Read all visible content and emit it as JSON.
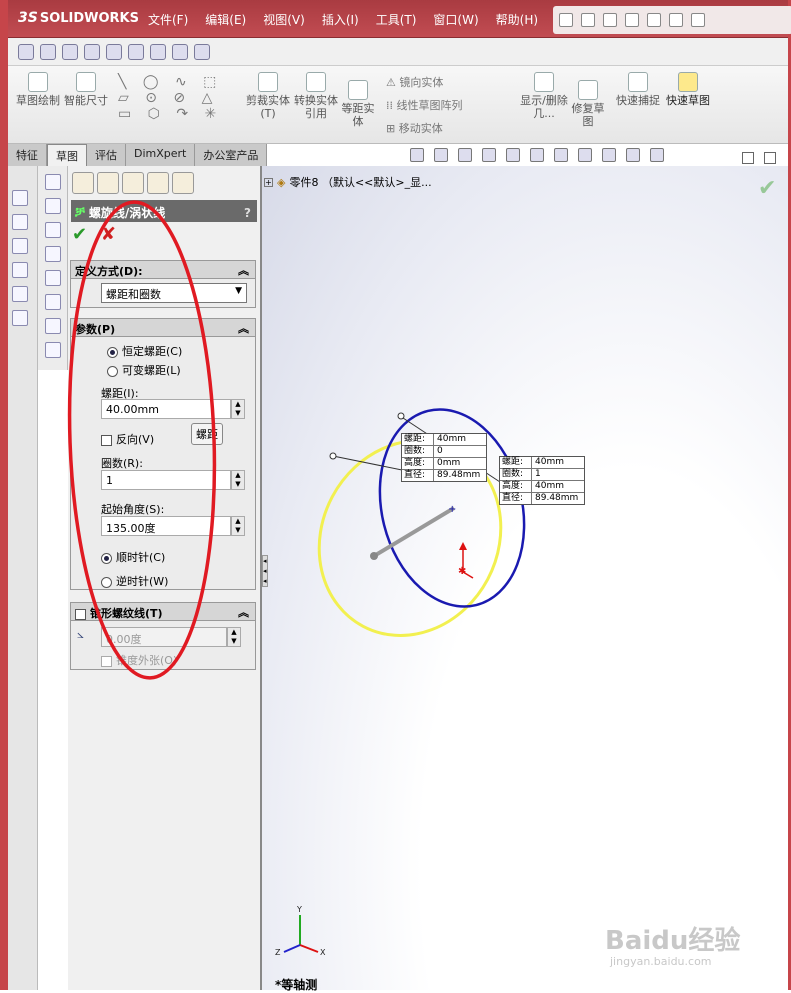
{
  "app": {
    "logo_text": "SOLIDWORKS",
    "logo_mark": "3S"
  },
  "menu": [
    "文件(F)",
    "编辑(E)",
    "视图(V)",
    "插入(I)",
    "工具(T)",
    "窗口(W)",
    "帮助(H)"
  ],
  "command_manager": {
    "sketch": "草图绘制",
    "smart_dim": "智能尺寸",
    "trim": "剪裁实体(T)",
    "convert": "转换实体引用",
    "offset": "等距实体",
    "mirror": "镜向实体",
    "linear_pattern": "线性草图阵列",
    "move": "移动实体",
    "show_delete": "显示/删除几...",
    "repair": "修复草图",
    "quick_snap": "快速捕捉",
    "rapid_sketch": "快速草图"
  },
  "tabs": [
    "特征",
    "草图",
    "评估",
    "DimXpert",
    "办公室产品"
  ],
  "active_tab": "草图",
  "tree": {
    "node": "零件8 （默认<<默认>_显..."
  },
  "property_manager": {
    "title": "螺旋线/涡状线",
    "help": "?",
    "define_group": {
      "header": "定义方式(D):",
      "value": "螺距和圈数"
    },
    "params_group": {
      "header": "参数(P)",
      "constant_pitch": "恒定螺距(C)",
      "variable_pitch": "可变螺距(L)",
      "pitch_label": "螺距(I):",
      "pitch_value": "40.00mm",
      "reverse": "反向(V)",
      "pitch_button": "螺距",
      "revolutions_label": "圈数(R):",
      "revolutions_value": "1",
      "start_angle_label": "起始角度(S):",
      "start_angle_value": "135.00度",
      "clockwise": "顺时针(C)",
      "counterclockwise": "逆时针(W)"
    },
    "taper_group": {
      "header": "锥形螺纹线(T)",
      "angle_value": "0.00度",
      "taper_outward": "锥度外张(O)"
    }
  },
  "callout_1": [
    [
      "螺距:",
      "40mm"
    ],
    [
      "圈数:",
      "0"
    ],
    [
      "高度:",
      "0mm"
    ],
    [
      "直径:",
      "89.48mm"
    ]
  ],
  "callout_2": [
    [
      "螺距:",
      "40mm"
    ],
    [
      "圈数:",
      "1"
    ],
    [
      "高度:",
      "40mm"
    ],
    [
      "直径:",
      "89.48mm"
    ]
  ],
  "view_label": "*等轴测",
  "triad": {
    "x": "X",
    "y": "Y",
    "z": "Z"
  },
  "watermark": {
    "main": "Baidu经验",
    "sub": "jingyan.baidu.com"
  },
  "colors": {
    "frame": "#c6454a",
    "helix_preview": "#1a1ab0",
    "helix_start": "#f2f050",
    "annotation": "#e01a22"
  }
}
